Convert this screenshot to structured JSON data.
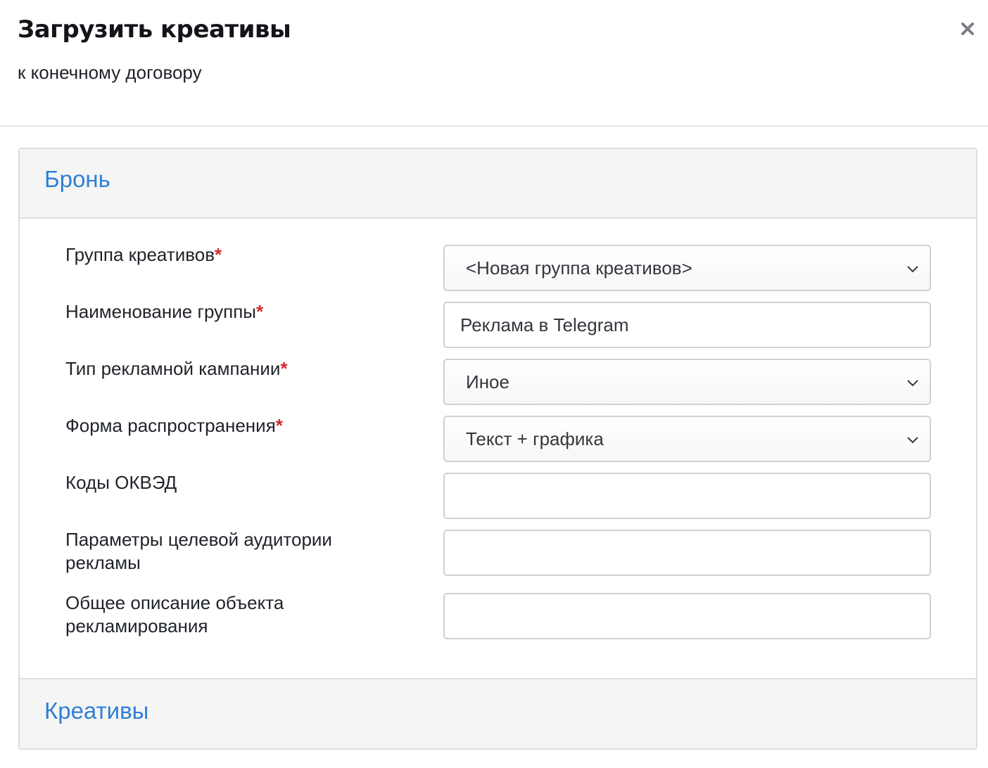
{
  "dialog": {
    "title": "Загрузить креативы",
    "subtitle": "к конечному договору",
    "close_icon": "close-icon"
  },
  "sections": {
    "booking": {
      "label": "Бронь"
    },
    "creatives": {
      "label": "Креативы"
    }
  },
  "form": {
    "required_mark": "*",
    "creative_group": {
      "label": "Группа креативов",
      "value": "<Новая группа креативов>"
    },
    "group_name": {
      "label": "Наименование группы",
      "value": "Реклама в Telegram"
    },
    "campaign_type": {
      "label": "Тип рекламной кампании",
      "value": "Иное"
    },
    "distribution_form": {
      "label": "Форма распространения",
      "value": "Текст + графика"
    },
    "okved_codes": {
      "label": "Коды ОКВЭД",
      "value": ""
    },
    "target_audience": {
      "label": "Параметры целевой аудитории рекламы",
      "value": ""
    },
    "object_description": {
      "label": "Общее описание объекта рекламирования",
      "value": ""
    }
  },
  "colors": {
    "accent": "#2f7fd6",
    "required": "#d22b2b"
  }
}
